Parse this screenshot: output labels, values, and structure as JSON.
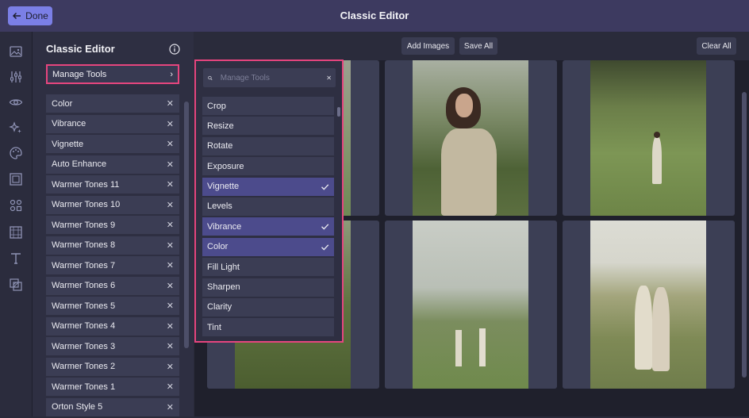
{
  "header": {
    "title": "Classic Editor",
    "done_label": "Done"
  },
  "sidebar_icons": [
    "image-icon",
    "sliders-icon",
    "eye-icon",
    "sparkle-icon",
    "palette-icon",
    "frame-icon",
    "elements-icon",
    "overlay-icon",
    "text-icon",
    "texture-icon"
  ],
  "panel": {
    "title": "Classic Editor",
    "manage_label": "Manage Tools",
    "tools": [
      "Color",
      "Vibrance",
      "Vignette",
      "Auto Enhance",
      "Warmer Tones 11",
      "Warmer Tones 10",
      "Warmer Tones 9",
      "Warmer Tones 8",
      "Warmer Tones 7",
      "Warmer Tones 6",
      "Warmer Tones 5",
      "Warmer Tones 4",
      "Warmer Tones 3",
      "Warmer Tones 2",
      "Warmer Tones 1",
      "Orton Style 5"
    ]
  },
  "canvas": {
    "add_images": "Add Images",
    "save_all": "Save All",
    "clear_all": "Clear All"
  },
  "dropdown": {
    "search_placeholder": "Manage Tools",
    "items": [
      {
        "label": "Crop",
        "selected": false
      },
      {
        "label": "Resize",
        "selected": false
      },
      {
        "label": "Rotate",
        "selected": false
      },
      {
        "label": "Exposure",
        "selected": false
      },
      {
        "label": "Vignette",
        "selected": true
      },
      {
        "label": "Levels",
        "selected": false
      },
      {
        "label": "Vibrance",
        "selected": true
      },
      {
        "label": "Color",
        "selected": true
      },
      {
        "label": "Fill Light",
        "selected": false
      },
      {
        "label": "Sharpen",
        "selected": false
      },
      {
        "label": "Clarity",
        "selected": false
      },
      {
        "label": "Tint",
        "selected": false
      }
    ]
  },
  "colors": {
    "accent": "#e6457e",
    "header": "#3d3a60",
    "done": "#7b7fe6",
    "selected": "#4c4b8c"
  }
}
